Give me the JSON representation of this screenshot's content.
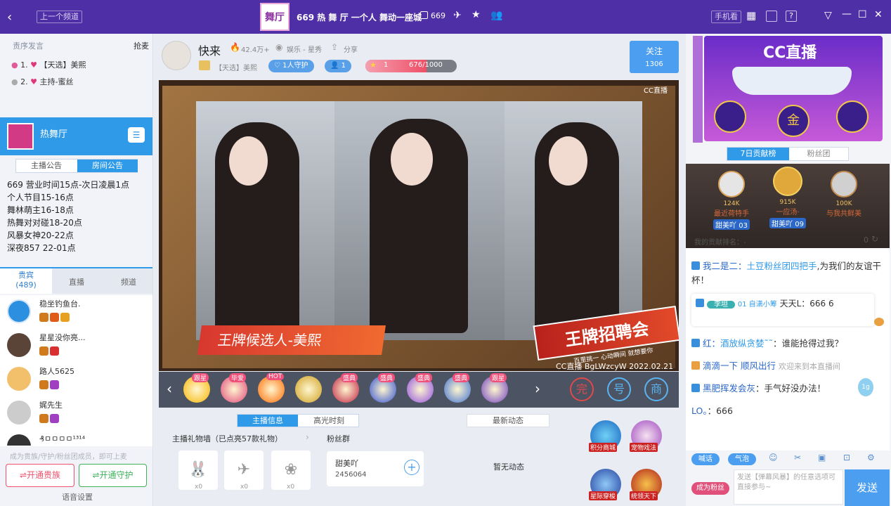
{
  "topbar": {
    "prev_channel": "上一个频道",
    "room_title": "669 热 舞 厅 一个人 舞动一座城",
    "room_count": "669",
    "logo_text": "舞厅",
    "phone": "手机看"
  },
  "left": {
    "header": {
      "title": "责序发言",
      "grab": "抢麦"
    },
    "queue": [
      {
        "num": "1.",
        "tag": "【天选】美熙"
      },
      {
        "num": "2.",
        "tag": "主持-蜜丝"
      }
    ],
    "channel": {
      "name": "热舞厅"
    },
    "notice_tabs": [
      "主播公告",
      "房间公告"
    ],
    "notice_lines": [
      "669 营业时间15点-次日凌晨1点",
      "个人节目15-16点",
      "舞林萌主16-18点",
      "热舞对对碰18-20点",
      "风暴女神20-22点",
      "深夜857  22-01点"
    ],
    "tabs": {
      "nobles": "贵宾",
      "nobles_count": "(489)",
      "live": "直播",
      "channel": "频道"
    },
    "users": [
      {
        "name": "稳坐钓鱼台."
      },
      {
        "name": "星星没你亮..."
      },
      {
        "name": "路人5625"
      },
      {
        "name": "娓先生"
      },
      {
        "name": "₰ㅁㅁㅁㅁ¹³¹⁴"
      }
    ],
    "footer_hint": "成为贵族/守护/粉丝团成员，即可上麦",
    "btn_noble": "开通贵族",
    "btn_guard": "开通守护",
    "voice_settings": "语音设置"
  },
  "streamer": {
    "name": "快来",
    "heat": "42.4万+",
    "category": "娱乐 - 星秀",
    "share": "分享",
    "tag": "【天选】美熙",
    "guard": "1人守护",
    "fans": "1",
    "level": "1",
    "exp": "676/1000",
    "follow": "关注",
    "follow_count": "1306"
  },
  "video": {
    "caption": "王牌候选人-美熙",
    "watermark": "CC直播",
    "id_text": "CC直播 BgLWzcyW 2022.02.21",
    "banner_big": "王牌招聘会",
    "banner_small": "百里挑一 心动瞬间 就想要你"
  },
  "gifts": [
    {
      "tag": "跟星",
      "color": "#f7b500"
    },
    {
      "tag": "毕爱",
      "color": "#e0467a"
    },
    {
      "tag": "HOT",
      "color": "#ff6a00"
    },
    {
      "tag": "",
      "color": "#d0a020"
    },
    {
      "tag": "盛典",
      "color": "#c02040"
    },
    {
      "tag": "盛典",
      "color": "#3050d0"
    },
    {
      "tag": "盛典",
      "color": "#9050e0"
    },
    {
      "tag": "盛典",
      "color": "#4070d0"
    },
    {
      "tag": "跟星",
      "color": "#7040c0"
    }
  ],
  "gift_actions": [
    "完",
    "号",
    "商"
  ],
  "info": {
    "tabs": [
      "主播信息",
      "高光时刻"
    ],
    "dynamic_tab": "最新动态",
    "wall_title": "主播礼物墙（已点亮57款礼物）",
    "fans_group": "粉丝群",
    "fan_name": "甜美吖",
    "fan_id": "2456064",
    "no_dynamic": "暂无动态",
    "wall_counts": [
      "x0",
      "x0",
      "x0"
    ]
  },
  "features": [
    {
      "label": "积分商城"
    },
    {
      "label": "宠物戏法"
    },
    {
      "label": "星际穿梭"
    },
    {
      "label": "统领天下"
    }
  ],
  "right": {
    "ad_text": "CC直播",
    "contrib_tabs": [
      "7日贡献榜",
      "粉丝团"
    ],
    "ranks": [
      {
        "score": "124K",
        "label": "最近荷特手",
        "tag": "甜美吖",
        "lv": "03"
      },
      {
        "score": "915K",
        "label": "一应汤·",
        "tag": "甜美吖",
        "lv": "09"
      },
      {
        "score": "100K",
        "label": "与我共鲜美",
        "tag": "",
        "lv": ""
      }
    ],
    "my_rank": "我的贡献排名：-",
    "my_rank_val": "0",
    "chat": [
      {
        "user": "我二是二",
        "sep": "：",
        "link": "土豆粉丝团四把手",
        "text": ",为我们的友谊干杯！"
      },
      {
        "user": "李坦",
        "sep": "",
        "link": "01 自潇小筹",
        "text": "天天L：666 6"
      },
      {
        "user": "红",
        "sep": "：",
        "link": "酒放纵贪婪˜˜",
        "text": "：谁能抢得过我？"
      },
      {
        "user": "滴滴一下 顺风出行",
        "sep": "",
        "link": "",
        "text": "欢迎来到本直播间"
      },
      {
        "user": "黑肥挥发会灰",
        "sep": "",
        "link": "",
        "text": "：手气好没办法！"
      },
      {
        "user": "LO。",
        "sep": "",
        "link": "",
        "text": "：666"
      }
    ],
    "chat_tools": {
      "shout": "喊话",
      "bubble": "气泡"
    },
    "become_fan": "成为粉丝",
    "input_placeholder": "发送【弹幕风暴】的任意选项可直接参与~",
    "send": "发送"
  }
}
